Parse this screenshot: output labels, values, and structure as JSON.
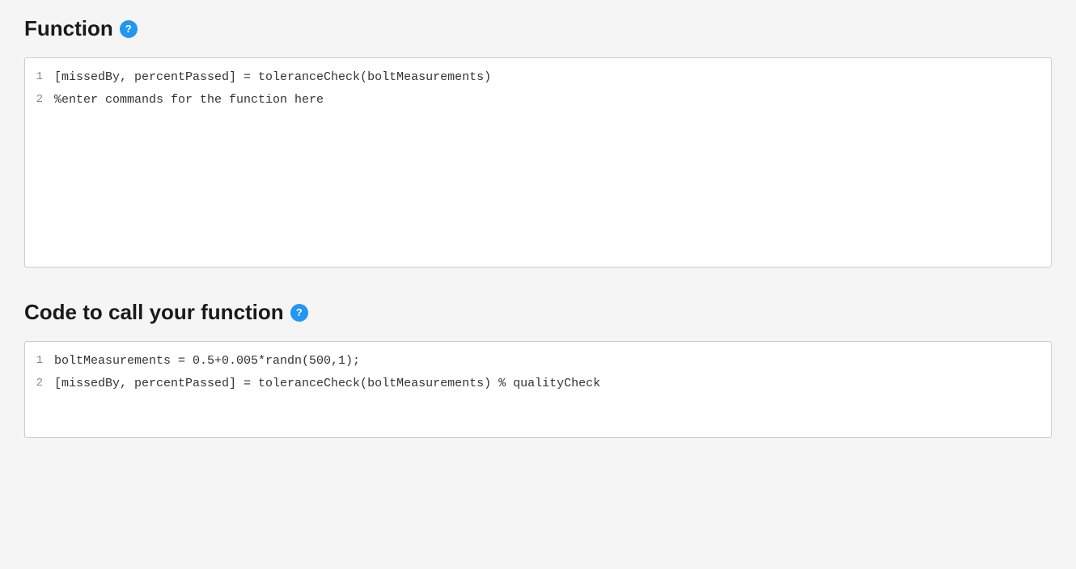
{
  "function_section": {
    "title": "Function",
    "help_icon_label": "?",
    "code_lines": [
      {
        "number": "1",
        "content": "[missedBy, percentPassed] = toleranceCheck(boltMeasurements)"
      },
      {
        "number": "2",
        "content": "%enter commands for the function here"
      }
    ]
  },
  "call_section": {
    "title": "Code to call your function",
    "help_icon_label": "?",
    "code_lines": [
      {
        "number": "1",
        "content": "boltMeasurements = 0.5+0.005*randn(500,1);"
      },
      {
        "number": "2",
        "content": "[missedBy, percentPassed] = toleranceCheck(boltMeasurements) % qualityCheck"
      }
    ]
  }
}
